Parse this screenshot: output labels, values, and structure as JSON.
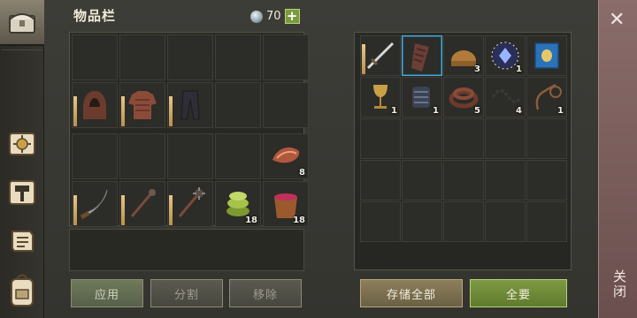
{
  "header": {
    "title": "物品栏",
    "coin_count": "70",
    "plus": "+"
  },
  "sidebar": {
    "items": [
      {
        "icon": "chest-icon",
        "active": true
      },
      {
        "icon": "sun-scroll-icon"
      },
      {
        "icon": "hammer-icon"
      },
      {
        "icon": "scroll-icon"
      },
      {
        "icon": "backpack-icon"
      }
    ]
  },
  "inventory_top": [
    "",
    "",
    "",
    "",
    "",
    {
      "icon": "hood-icon",
      "durability": true
    },
    {
      "icon": "shirt-icon",
      "durability": true
    },
    {
      "icon": "pants-icon",
      "durability": true
    },
    "",
    ""
  ],
  "inventory_bottom": [
    "",
    "",
    "",
    "",
    {
      "icon": "meat-icon",
      "qty": "8"
    },
    {
      "icon": "sickle-icon",
      "durability": true
    },
    {
      "icon": "mace-icon",
      "durability": true
    },
    {
      "icon": "spiked-mace-icon",
      "durability": true
    },
    {
      "icon": "herb-icon",
      "qty": "18"
    },
    {
      "icon": "bucket-icon",
      "qty": "18"
    }
  ],
  "storage": [
    {
      "icon": "sword-icon",
      "durability": true
    },
    {
      "icon": "rolled-leather-icon",
      "selected": true
    },
    {
      "icon": "bread-icon",
      "qty": "3"
    },
    {
      "icon": "gem-icon",
      "qty": "1"
    },
    {
      "icon": "book-icon"
    },
    {
      "icon": "goblet-icon",
      "qty": "1"
    },
    {
      "icon": "gauntlet-icon",
      "qty": "1"
    },
    {
      "icon": "leather-strips-icon",
      "qty": "5"
    },
    {
      "icon": "chain-icon",
      "qty": "4"
    },
    {
      "icon": "rope-icon",
      "qty": "1"
    },
    "",
    "",
    "",
    "",
    "",
    "",
    "",
    "",
    "",
    "",
    "",
    "",
    "",
    "",
    ""
  ],
  "buttons": {
    "apply": "应用",
    "split": "分割",
    "remove": "移除",
    "store_all": "存储全部",
    "take_all": "全要"
  },
  "close": {
    "x": "✕",
    "label": "关闭"
  },
  "colors": {
    "accent_green": "#7e9a43",
    "selection_blue": "#4aa7d6",
    "close_red": "#8a6d6a"
  }
}
